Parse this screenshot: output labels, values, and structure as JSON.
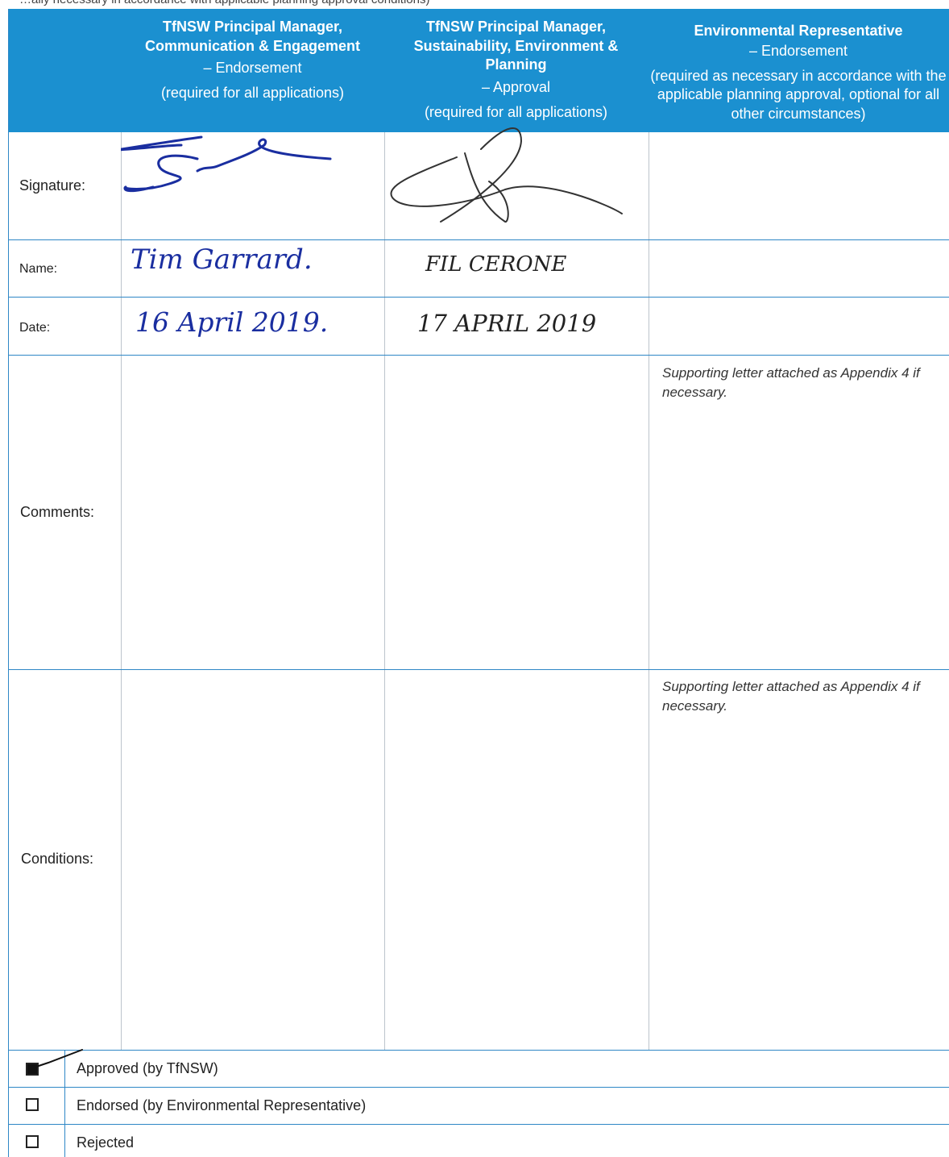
{
  "top_fragment": "…ally necessary in accordance with applicable planning approval conditions)",
  "header": {
    "col1": {
      "title": "TfNSW Principal Manager, Communication & Engagement",
      "role": "– Endorsement",
      "requirement": "(required for all applications)"
    },
    "col2": {
      "title": "TfNSW Principal Manager, Sustainability, Environment & Planning",
      "role": "– Approval",
      "requirement": "(required for all applications)"
    },
    "col3": {
      "title": "Environmental Representative",
      "role": "– Endorsement",
      "requirement": "(required as necessary in accordance with the applicable planning approval, optional for all other circumstances)"
    }
  },
  "rows": {
    "signature": "Signature:",
    "name": "Name:",
    "date": "Date:",
    "comments": "Comments:",
    "conditions": "Conditions:"
  },
  "entries": {
    "name_col1": "Tim Garrard.",
    "name_col2": "FIL CERONE",
    "date_col1": "16 April 2019.",
    "date_col2": "17 APRIL 2019"
  },
  "notes": {
    "comments_col3": "Supporting letter attached as Appendix 4 if necessary.",
    "conditions_col3": "Supporting letter attached as Appendix 4 if necessary."
  },
  "status": [
    {
      "label": "Approved (by TfNSW)",
      "checked": true
    },
    {
      "label": "Endorsed (by Environmental Representative)",
      "checked": false
    },
    {
      "label": "Rejected",
      "checked": false
    }
  ],
  "colors": {
    "header_bg": "#1b90d0",
    "grid_line": "#2e87c6",
    "ink_blue": "#1a2ea0"
  }
}
